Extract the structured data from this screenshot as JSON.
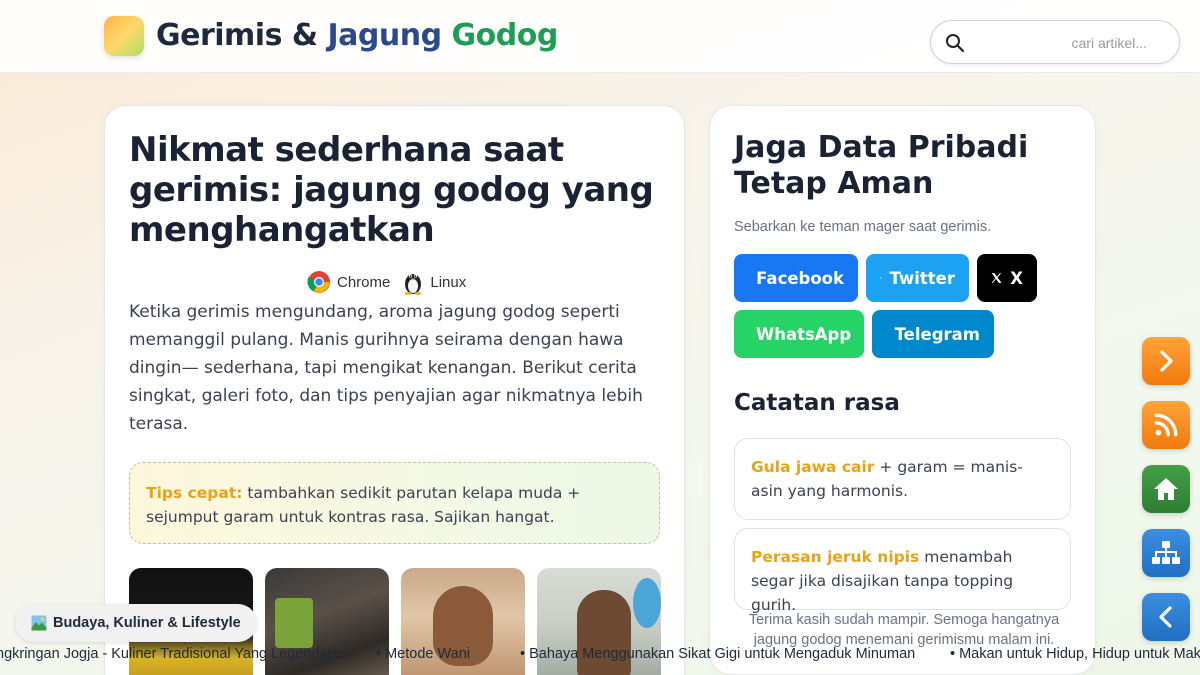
{
  "header": {
    "brand_part1": "Gerimis & ",
    "brand_part2": "Jagung ",
    "brand_part3": "Godog",
    "search_placeholder": "cari artikel..."
  },
  "article": {
    "title": "Nikmat sederhana saat gerimis: jagung godog yang menghangatkan",
    "badges": [
      {
        "label": "Chrome",
        "icon": "chrome-icon"
      },
      {
        "label": "Linux",
        "icon": "linux-tux-icon"
      }
    ],
    "body": "Ketika gerimis mengundang, aroma jagung godog seperti memanggil pulang. Manis gurihnya seirama dengan hawa dingin— sederhana, tapi mengikat kenangan. Berikut cerita singkat, galeri foto, dan tips penyajian agar nikmatnya lebih terasa.",
    "tips_label": "Tips cepat:",
    "tips_text": " tambahkan sedikit parutan kelapa muda + sejumput garam untuk kontras rasa. Sajikan hangat."
  },
  "side": {
    "title": "Jaga Data Pribadi Tetap Aman",
    "subtitle": "Sebarkan ke teman mager saat gerimis.",
    "share": {
      "facebook": "Facebook",
      "twitter": "Twitter",
      "x": "X",
      "whatsapp": "WhatsApp",
      "telegram": "Telegram"
    },
    "notes_title": "Catatan rasa",
    "notes": [
      {
        "highlight": "Gula jawa cair",
        "text": " + garam = manis-asin yang harmonis."
      },
      {
        "highlight": "Perasan jeruk nipis",
        "text": " menambah segar jika disajikan tanpa topping gurih."
      }
    ],
    "thanks": "Terima kasih sudah mampir. Semoga hangatnya jagung godog menemani gerimismu malam ini."
  },
  "chip": {
    "icon": "landscape-icon",
    "label": "Budaya, Kuliner & Lifestyle"
  },
  "ticker": [
    "ngkringan Jogja - Kuliner Tradisional Yang Legendaris",
    "• Metode Wani",
    "• Bahaya Menggunakan Sikat Gigi untuk Mengaduk Minuman",
    "• Makan untuk Hidup, Hidup untuk Mak"
  ],
  "colors": {
    "facebook": "#1877f2",
    "twitter": "#1da1f2",
    "x": "#000000",
    "whatsapp": "#25d366",
    "telegram": "#0088cc",
    "accent": "#e8a21a",
    "brand_green": "#1f9d55"
  }
}
